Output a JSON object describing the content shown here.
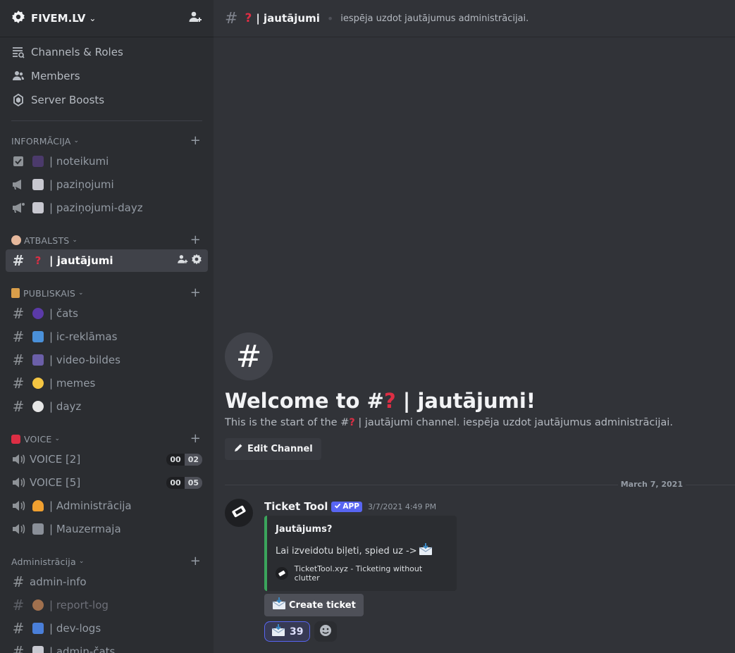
{
  "server": {
    "name": "FIVEM.LV"
  },
  "nav": [
    {
      "label": "Channels & Roles",
      "icon": "channels-roles-icon"
    },
    {
      "label": "Members",
      "icon": "members-icon"
    },
    {
      "label": "Server Boosts",
      "icon": "boost-icon"
    }
  ],
  "categories": {
    "informacija": {
      "name": "INFORMĀCIJA",
      "channels": [
        {
          "name": "| noteikumi"
        },
        {
          "name": "| paziņojumi"
        },
        {
          "name": "| paziņojumi-dayz"
        }
      ]
    },
    "atbalsts": {
      "name": "ATBALSTS",
      "channels": [
        {
          "name": "| jautājumi"
        }
      ]
    },
    "publiskais": {
      "name": "PUBLISKAIS",
      "channels": [
        {
          "name": "| čats"
        },
        {
          "name": "| ic-reklāmas"
        },
        {
          "name": "| video-bildes"
        },
        {
          "name": "| memes"
        },
        {
          "name": "| dayz"
        }
      ]
    },
    "voice": {
      "name": "VOICE",
      "channels": [
        {
          "name": "VOICE [2]",
          "count_a": "00",
          "count_b": "02"
        },
        {
          "name": "VOICE [5]",
          "count_a": "00",
          "count_b": "05"
        },
        {
          "name": "| Administrācija"
        },
        {
          "name": "| Mauzermaja"
        }
      ]
    },
    "administracija": {
      "name": "Administrācija",
      "channels": [
        {
          "name": "admin-info"
        },
        {
          "name": "| report-log"
        },
        {
          "name": "| dev-logs"
        },
        {
          "name": "| admin-čats"
        }
      ]
    }
  },
  "topbar": {
    "channel": "| jautājumi",
    "topic": "iespēja uzdot jautājumus administrācijai."
  },
  "welcome": {
    "title_prefix": "Welcome to #",
    "title_suffix": " | jautājumi!",
    "desc_prefix": "This is the start of the #",
    "desc_suffix": " | jautājumi channel. iespēja uzdot jautājumus administrācijai.",
    "edit_label": "Edit Channel"
  },
  "date_separator": "March 7, 2021",
  "message": {
    "author": "Ticket Tool",
    "badge": "APP",
    "timestamp": "3/7/2021 4:49 PM",
    "embed": {
      "title": "Jautājums?",
      "description": "Lai izveidotu biļeti, spied uz ->",
      "footer": "TicketTool.xyz - Ticketing without clutter",
      "color": "#3ba55c"
    },
    "button_label": "Create ticket",
    "reaction_count": "39"
  },
  "colors": {
    "accent": "#5865f2",
    "sidebar": "#2b2d31",
    "main": "#313338"
  }
}
